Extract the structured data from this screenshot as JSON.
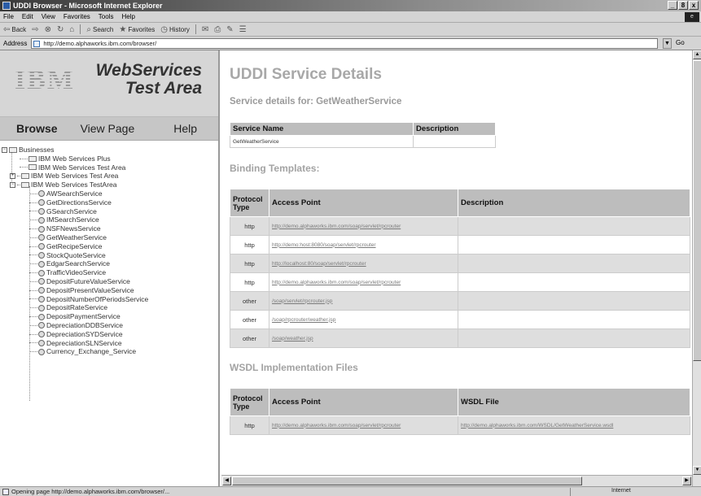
{
  "window": {
    "title": "UDDI Browser - Microsoft Internet Explorer",
    "controls": [
      "_",
      "8",
      "x"
    ]
  },
  "menubar": {
    "items": [
      "File",
      "Edit",
      "View",
      "Favorites",
      "Tools",
      "Help"
    ]
  },
  "toolbar": {
    "back": "Back",
    "search": "Search",
    "favorites": "Favorites",
    "history": "History"
  },
  "addressbar": {
    "label": "Address",
    "url": "http://demo.alphaworks.ibm.com/browser/",
    "go": "Go"
  },
  "left": {
    "logo": "IBM",
    "brand_line1": "WebServices",
    "brand_line2": "Test Area",
    "nav": [
      "Browse",
      "View Page",
      "Help"
    ],
    "tree": {
      "root": "Businesses",
      "businesses": [
        "IBM Web Services Plus",
        "IBM Web Services Test Area",
        "IBM Web Services Test Area",
        "IBM Web Services TestArea"
      ],
      "services": [
        "AWSearchService",
        "GetDirectionsService",
        "GSearchService",
        "IMSearchService",
        "NSFNewsService",
        "GetWeatherService",
        "GetRecipeService",
        "StockQuoteService",
        "EdgarSearchService",
        "TrafficVideoService",
        "DepositFutureValueService",
        "DepositPresentValueService",
        "DepositNumberOfPeriodsService",
        "DepositRateService",
        "DepositPaymentService",
        "DepreciationDDBService",
        "DepreciationSYDService",
        "DepreciationSLNService",
        "Currency_Exchange_Service"
      ]
    }
  },
  "main": {
    "title": "UDDI Service Details",
    "subtitle": "Service details for: GetWeatherService",
    "service_table": {
      "headers": [
        "Service Name",
        "Description"
      ],
      "row": [
        "GetWeatherService",
        ""
      ]
    },
    "binding_title": "Binding Templates:",
    "binding_table": {
      "headers": [
        "Protocol Type",
        "Access Point",
        "Description"
      ],
      "rows": [
        [
          "http",
          "http://demo.alphaworks.ibm.com/soap/servlet/rpcrouter",
          ""
        ],
        [
          "http",
          "http://demo:host:8080/soap/servlet/rpcrouter",
          ""
        ],
        [
          "http",
          "http://localhost:80/soap/servlet/rpcrouter",
          ""
        ],
        [
          "http",
          "http://demo.alphaworks.ibm.com/soap/servlet/rpcrouter",
          ""
        ],
        [
          "other",
          "/soap/servlet/rpcrouter.jsp",
          ""
        ],
        [
          "other",
          "/soap/rpcrouter/weather.jsp",
          ""
        ],
        [
          "other",
          "/soap/weather.jsp",
          ""
        ]
      ]
    },
    "wsdl_title": "WSDL Implementation Files",
    "wsdl_table": {
      "headers": [
        "Protocol Type",
        "Access Point",
        "WSDL File"
      ],
      "rows": [
        [
          "http",
          "http://demo.alphaworks.ibm.com/soap/servlet/rpcrouter",
          "http://demo.alphaworks.ibm.com/WSDL/GetWeatherService.wsdl"
        ]
      ]
    }
  },
  "statusbar": {
    "text": "Opening page http://demo.alphaworks.ibm.com/browser/...",
    "zone": "Internet"
  }
}
